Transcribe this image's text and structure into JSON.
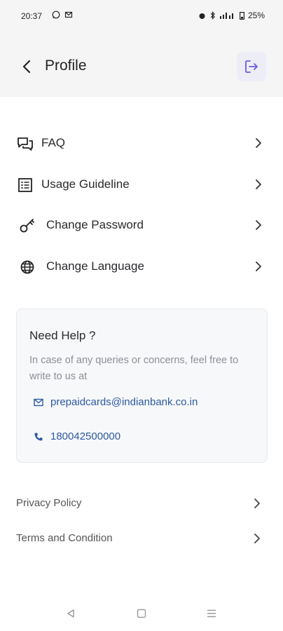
{
  "status_bar": {
    "time": "20:37",
    "battery": "25%"
  },
  "header": {
    "title": "Profile"
  },
  "menu": [
    {
      "label": "FAQ",
      "icon": "faq-icon"
    },
    {
      "label": "Usage Guideline",
      "icon": "guideline-icon"
    },
    {
      "label": "Change Password",
      "icon": "key-icon"
    },
    {
      "label": "Change Language",
      "icon": "globe-icon"
    }
  ],
  "help": {
    "title": "Need Help ?",
    "description": "In case of any queries or concerns, feel free to write to us at",
    "email": "prepaidcards@indianbank.co.in",
    "phone": "180042500000"
  },
  "links": [
    {
      "label": "Privacy Policy"
    },
    {
      "label": "Terms and Condition"
    }
  ],
  "colors": {
    "accent": "#2c5aa0",
    "logout_icon": "#6b5bd6",
    "header_bg": "#f5f5f6"
  }
}
